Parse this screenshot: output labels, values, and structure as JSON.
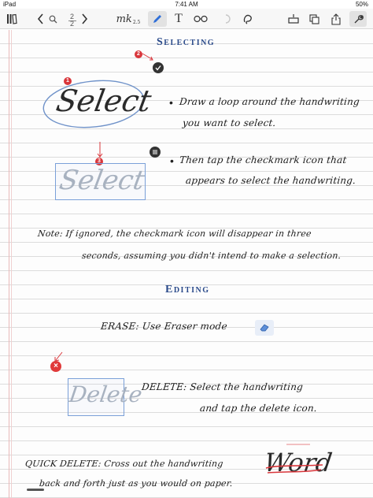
{
  "status": {
    "carrier": "iPad",
    "time": "7:41 AM",
    "battery": "50%"
  },
  "toolbar": {
    "page_current": "2",
    "page_total": "2",
    "app_label": "mk",
    "app_sub": "2.5",
    "text_tool": "T",
    "icons": [
      "library-icon",
      "back-icon",
      "search-icon",
      "forward-icon",
      "pen-icon",
      "text-icon",
      "glasses-icon",
      "undo-icon",
      "lasso-icon",
      "insert-icon",
      "copy-icon",
      "share-icon",
      "settings-icon"
    ]
  },
  "sections": {
    "selecting": {
      "title": "Selecting"
    },
    "editing": {
      "title": "Editing"
    }
  },
  "content": {
    "select_word": "Select",
    "select_word_2": "Select",
    "step1_line1": "Draw a loop around the handwriting",
    "step1_line2": "you want to select.",
    "step2_line1": "Then tap the checkmark icon that",
    "step2_line2": "appears to select the handwriting.",
    "note_line1": "Note: If ignored, the checkmark icon will disappear in three",
    "note_line2": "seconds, assuming you didn't intend to make a selection.",
    "erase_text": "ERASE: Use Eraser mode",
    "delete_word": "Delete",
    "delete_line1": "DELETE: Select the handwriting",
    "delete_line2": "and tap the delete icon.",
    "quick_line1": "QUICK DELETE: Cross out the handwriting",
    "quick_line2": "back and forth just as you would on paper.",
    "word_crossed": "Word",
    "badge_1": "1",
    "badge_2": "2",
    "badge_3": "3",
    "delete_x": "×"
  },
  "colors": {
    "heading": "#2a4a8a",
    "badge": "#d9363b",
    "selection": "#7aa0d8"
  }
}
